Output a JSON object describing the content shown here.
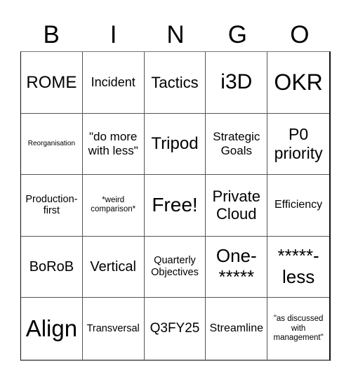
{
  "header": {
    "letters": [
      "B",
      "I",
      "N",
      "G",
      "O"
    ]
  },
  "grid": {
    "rows": [
      [
        "ROME",
        "Incident",
        "Tactics",
        "i3D",
        "OKR"
      ],
      [
        "Reorganisation",
        "\"do more with less\"",
        "Tripod",
        "Strategic Goals",
        "P0 priority"
      ],
      [
        "Production-first",
        "*weird comparison*",
        "Free!",
        "Private Cloud",
        "Efficiency"
      ],
      [
        "BoRoB",
        "Vertical",
        "Quarterly Objectives",
        "One-*****",
        "*****-less"
      ],
      [
        "Align",
        "Transversal",
        "Q3FY25",
        "Streamline",
        "\"as discussed with management\""
      ]
    ]
  }
}
